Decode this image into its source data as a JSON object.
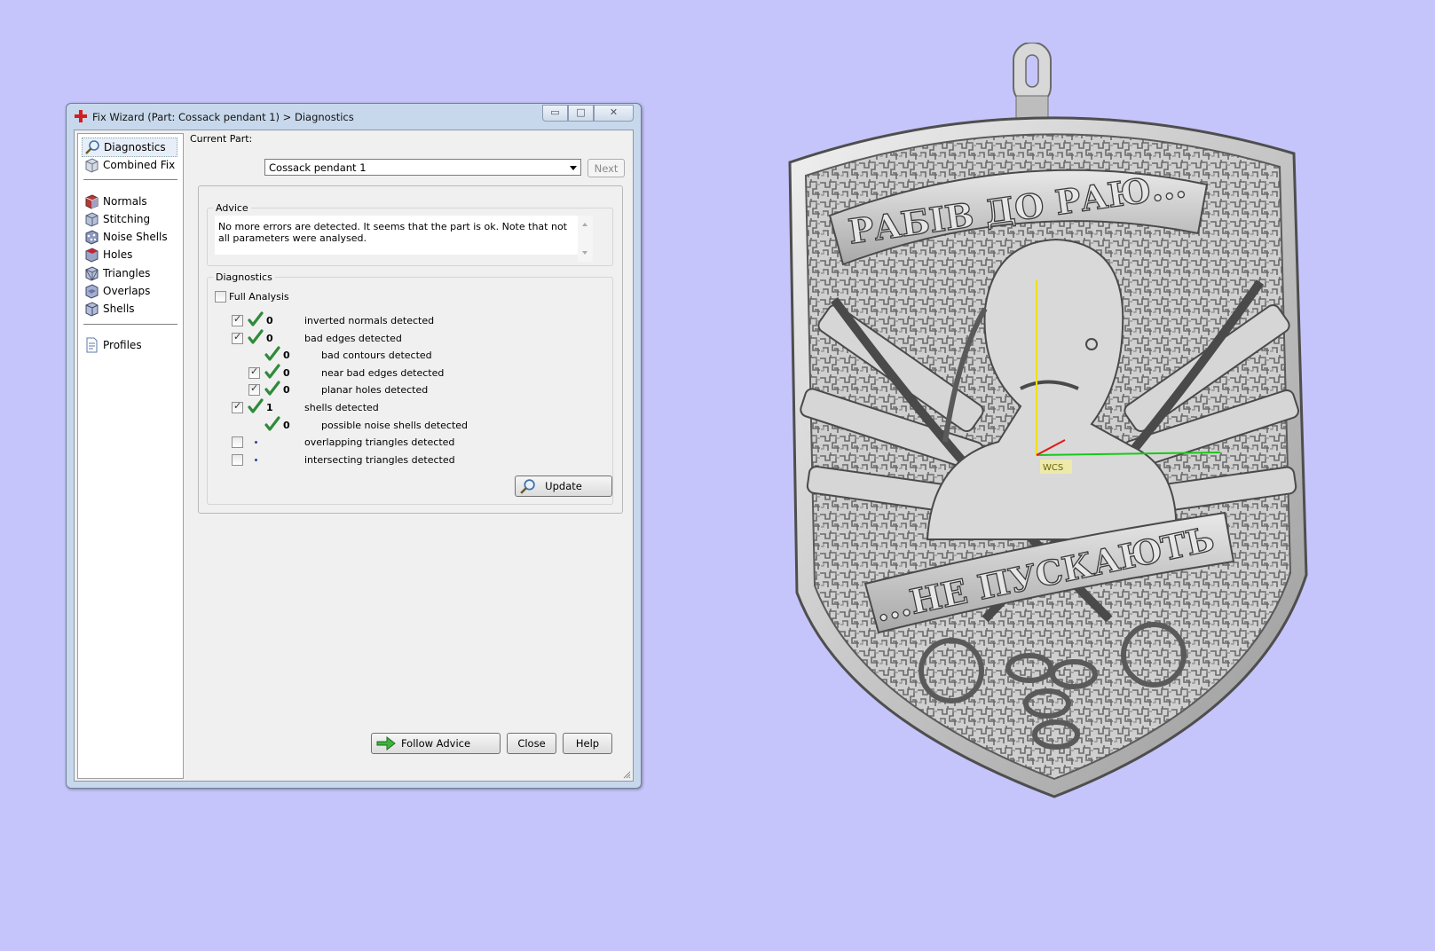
{
  "window": {
    "title": "Fix Wizard (Part: Cossack pendant 1) > Diagnostics",
    "controls": {
      "minimize": "▭",
      "maximize": "□",
      "close": "✕"
    }
  },
  "nav": {
    "items": [
      {
        "label": "Diagnostics",
        "icon": "magnifier-icon"
      },
      {
        "label": "Combined Fix",
        "icon": "cube-icon"
      },
      {
        "label": "Normals",
        "icon": "normals-cube-icon"
      },
      {
        "label": "Stitching",
        "icon": "stitching-cube-icon"
      },
      {
        "label": "Noise Shells",
        "icon": "noise-shells-icon"
      },
      {
        "label": "Holes",
        "icon": "holes-cube-icon"
      },
      {
        "label": "Triangles",
        "icon": "triangles-cube-icon"
      },
      {
        "label": "Overlaps",
        "icon": "overlaps-cube-icon"
      },
      {
        "label": "Shells",
        "icon": "shells-cube-icon"
      },
      {
        "label": "Profiles",
        "icon": "document-icon"
      }
    ]
  },
  "header": {
    "current_part_label": "Current Part:",
    "current_part_value": "Cossack pendant 1",
    "next_label": "Next"
  },
  "advice": {
    "title": "Advice",
    "text": "No more errors are detected. It seems that the part is ok. Note that not all parameters were analysed."
  },
  "diagnostics": {
    "title": "Diagnostics",
    "full_analysis_label": "Full Analysis",
    "rows": [
      {
        "checkbox": true,
        "checked": true,
        "status": "ok",
        "count": "0",
        "label": "inverted normals detected",
        "indent": 0
      },
      {
        "checkbox": true,
        "checked": true,
        "status": "ok",
        "count": "0",
        "label": "bad edges detected",
        "indent": 0
      },
      {
        "checkbox": false,
        "checked": false,
        "status": "ok",
        "count": "0",
        "label": "bad contours detected",
        "indent": 1
      },
      {
        "checkbox": true,
        "checked": true,
        "status": "ok",
        "count": "0",
        "label": "near bad edges detected",
        "indent": 1
      },
      {
        "checkbox": true,
        "checked": true,
        "status": "ok",
        "count": "0",
        "label": "planar holes detected",
        "indent": 1
      },
      {
        "checkbox": true,
        "checked": true,
        "status": "ok",
        "count": "1",
        "label": "shells detected",
        "indent": 0
      },
      {
        "checkbox": false,
        "checked": false,
        "status": "ok",
        "count": "0",
        "label": "possible noise shells detected",
        "indent": 1
      },
      {
        "checkbox": true,
        "checked": false,
        "status": "pending",
        "count": "",
        "label": "overlapping triangles detected",
        "indent": 0
      },
      {
        "checkbox": true,
        "checked": false,
        "status": "pending",
        "count": "",
        "label": "intersecting triangles detected",
        "indent": 0
      }
    ],
    "update_label": "Update"
  },
  "footer": {
    "follow_advice_label": "Follow Advice",
    "close_label": "Close",
    "help_label": "Help"
  },
  "model": {
    "top_banner": "РАБІВ ДО РАЮ...",
    "bottom_banner": "...НЕ ПУСКАЮТЬ",
    "axis_label": "WCS"
  },
  "colors": {
    "desktop": "#c5c5fb",
    "check_green": "#2f8a3a",
    "dot_blue": "#2a3fb0"
  }
}
